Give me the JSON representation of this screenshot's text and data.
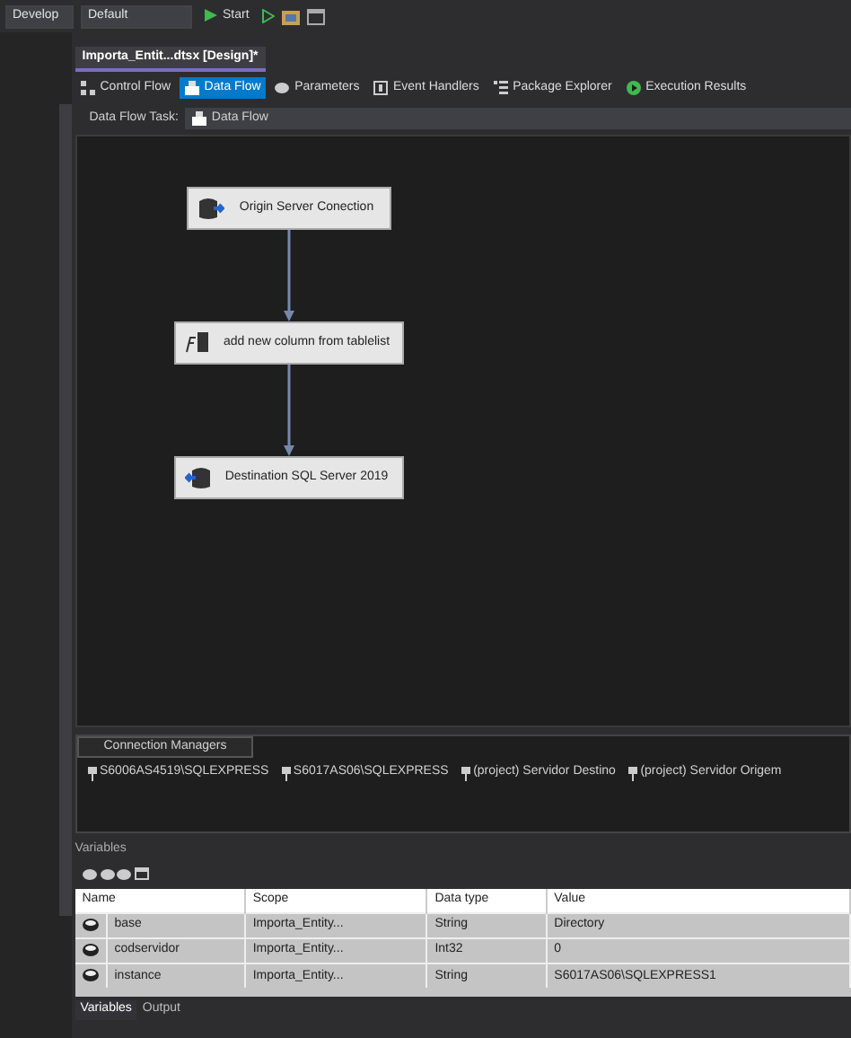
{
  "toolbar": {
    "configuration": "Develop",
    "platform": "Default",
    "start_label": "Start"
  },
  "document_tab": {
    "title": "Importa_Entit...dtsx [Design]*"
  },
  "designer_tabs": [
    {
      "label": "Control Flow",
      "kind": "control",
      "selected": false
    },
    {
      "label": "Data Flow",
      "kind": "dataflow",
      "selected": true
    },
    {
      "label": "Parameters",
      "kind": "params",
      "selected": false
    },
    {
      "label": "Event Handlers",
      "kind": "events",
      "selected": false
    },
    {
      "label": "Package Explorer",
      "kind": "explorer",
      "selected": false
    },
    {
      "label": "Execution Results",
      "kind": "results",
      "selected": false
    }
  ],
  "task_bar": {
    "label": "Data Flow Task:",
    "value": "Data Flow"
  },
  "components": [
    {
      "kind": "source",
      "label": "Origin Server Conection"
    },
    {
      "kind": "transform",
      "label": "add new column from tablelist"
    },
    {
      "kind": "destination",
      "label": "Destination SQL Server 2019"
    }
  ],
  "connection_managers": {
    "title": "Connection Managers",
    "items": [
      "S6006AS4519\\SQLEXPRESS",
      "S6017AS06\\SQLEXPRESS",
      "(project) Servidor Destino",
      "(project) Servidor Origem"
    ]
  },
  "variables": {
    "title": "Variables",
    "columns": [
      "Name",
      "Scope",
      "Data type",
      "Value"
    ],
    "rows": [
      [
        "base",
        "Importa_Entity...",
        "String",
        "Directory"
      ],
      [
        "codservidor",
        "Importa_Entity...",
        "Int32",
        "0"
      ],
      [
        "instance",
        "Importa_Entity...",
        "String",
        "S6017AS06\\SQLEXPRESS1"
      ]
    ]
  },
  "bottom_tabs": [
    {
      "label": "Variables",
      "selected": true
    },
    {
      "label": "Output",
      "selected": false
    }
  ]
}
